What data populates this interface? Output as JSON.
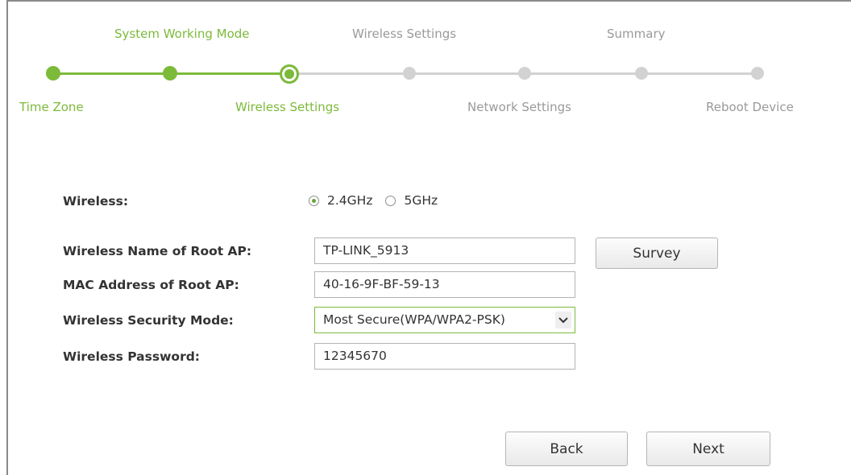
{
  "steps_top": [
    {
      "label": "System Working Mode",
      "status": "done"
    },
    {
      "label": "Wireless Settings",
      "status": "todo"
    },
    {
      "label": "Summary",
      "status": "todo"
    }
  ],
  "steps_bottom": [
    {
      "label": "Time Zone",
      "status": "done"
    },
    {
      "label": "Wireless Settings",
      "status": "current"
    },
    {
      "label": "Network Settings",
      "status": "todo"
    },
    {
      "label": "Reboot Device",
      "status": "todo"
    }
  ],
  "colors": {
    "active": "#7cba3a",
    "inactive": "#d2d2d2",
    "inactive_text": "#9a9a9a"
  },
  "form": {
    "wireless_label": "Wireless:",
    "band_options": [
      {
        "label": "2.4GHz",
        "checked": true
      },
      {
        "label": "5GHz",
        "checked": false
      }
    ],
    "root_ap_name_label": "Wireless Name of Root AP:",
    "root_ap_name_value": "TP-LINK_5913",
    "survey_button": "Survey",
    "mac_label": "MAC Address of Root AP:",
    "mac_value": "40-16-9F-BF-59-13",
    "security_mode_label": "Wireless Security Mode:",
    "security_mode_value": "Most Secure(WPA/WPA2-PSK)",
    "password_label": "Wireless Password:",
    "password_value": "12345670"
  },
  "actions": {
    "back": "Back",
    "next": "Next"
  }
}
